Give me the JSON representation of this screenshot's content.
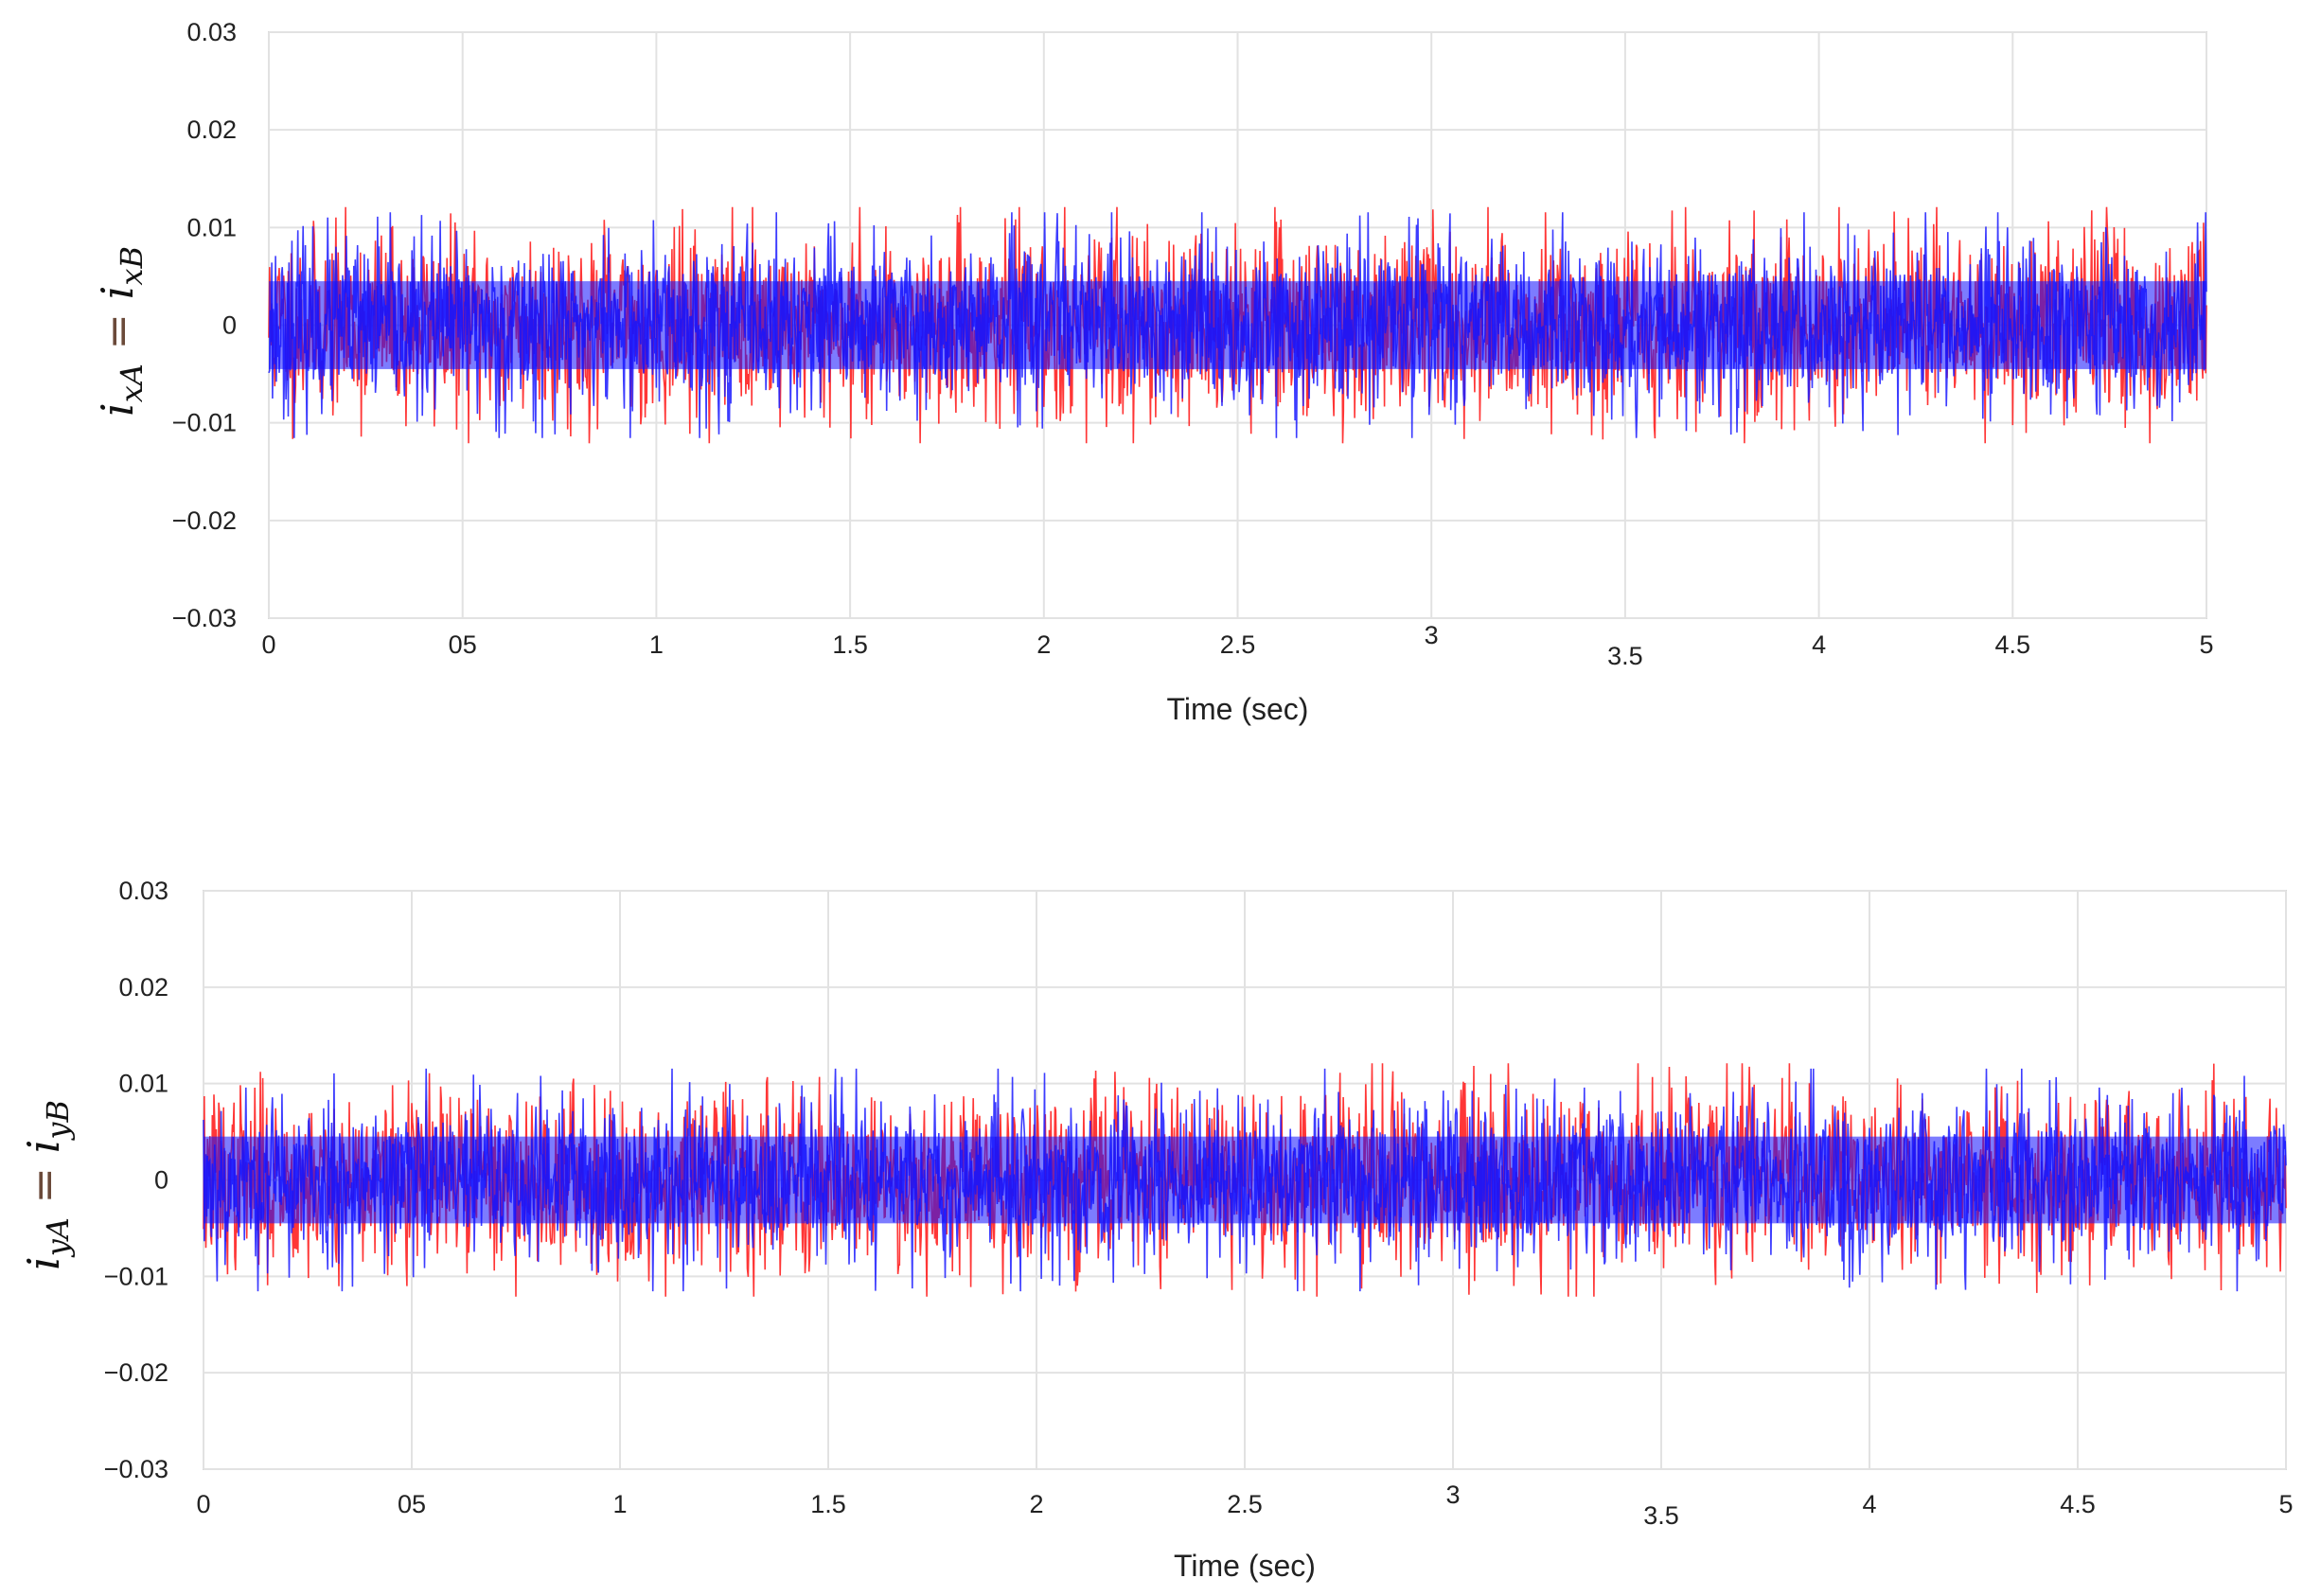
{
  "chart_data": [
    {
      "type": "line",
      "ylabel": "i_xA = i_xB",
      "ylabel_parts": {
        "a": "i",
        "a_sub": "xA",
        "eq": "=",
        "b": "i",
        "b_sub": "xB"
      },
      "xlabel": "Time (sec)",
      "xlim": [
        0,
        5
      ],
      "ylim": [
        -0.03,
        0.03
      ],
      "grid": true,
      "yticks": [
        {
          "v": 0.03,
          "label": "0.03"
        },
        {
          "v": 0.02,
          "label": "0.02"
        },
        {
          "v": 0.01,
          "label": "0.01"
        },
        {
          "v": 0,
          "label": "0"
        },
        {
          "v": -0.01,
          "label": "−0.01"
        },
        {
          "v": -0.02,
          "label": "−0.02"
        },
        {
          "v": -0.03,
          "label": "−0.03"
        }
      ],
      "xticks": [
        {
          "v": 0,
          "label": "0"
        },
        {
          "v": 0.5,
          "label": "05"
        },
        {
          "v": 1,
          "label": "1"
        },
        {
          "v": 1.5,
          "label": "1.5"
        },
        {
          "v": 2,
          "label": "2"
        },
        {
          "v": 2.5,
          "label": "2.5"
        },
        {
          "v": 3,
          "label": "3"
        },
        {
          "v": 3.5,
          "label": "3.5"
        },
        {
          "v": 4,
          "label": "4"
        },
        {
          "v": 4.5,
          "label": "4.5"
        },
        {
          "v": 5,
          "label": "5"
        }
      ],
      "series": [
        {
          "name": "red",
          "color": "#ff2020",
          "mean": 0,
          "amplitude": 0.011,
          "seed": 11
        },
        {
          "name": "blue",
          "color": "#1a1aff",
          "mean": 0,
          "amplitude": 0.0105,
          "seed": 23
        }
      ]
    },
    {
      "type": "line",
      "ylabel": "i_yA = i_yB",
      "ylabel_parts": {
        "a": "i",
        "a_sub": "yA",
        "eq": "=",
        "b": "i",
        "b_sub": "yB"
      },
      "xlabel": "Time (sec)",
      "xlim": [
        0,
        5
      ],
      "ylim": [
        -0.03,
        0.03
      ],
      "grid": true,
      "yticks": [
        {
          "v": 0.03,
          "label": "0.03"
        },
        {
          "v": 0.02,
          "label": "0.02"
        },
        {
          "v": 0.01,
          "label": "0.01"
        },
        {
          "v": 0,
          "label": "0"
        },
        {
          "v": -0.01,
          "label": "−0.01"
        },
        {
          "v": -0.02,
          "label": "−0.02"
        },
        {
          "v": -0.03,
          "label": "−0.03"
        }
      ],
      "xticks": [
        {
          "v": 0,
          "label": "0"
        },
        {
          "v": 0.5,
          "label": "05"
        },
        {
          "v": 1,
          "label": "1"
        },
        {
          "v": 1.5,
          "label": "1.5"
        },
        {
          "v": 2,
          "label": "2"
        },
        {
          "v": 2.5,
          "label": "2.5"
        },
        {
          "v": 3,
          "label": "3"
        },
        {
          "v": 3.5,
          "label": "3.5"
        },
        {
          "v": 4,
          "label": "4"
        },
        {
          "v": 4.5,
          "label": "4.5"
        },
        {
          "v": 5,
          "label": "5"
        }
      ],
      "series": [
        {
          "name": "red",
          "color": "#ff2020",
          "mean": 0,
          "amplitude": 0.011,
          "seed": 37
        },
        {
          "name": "blue",
          "color": "#1a1aff",
          "mean": 0,
          "amplitude": 0.0105,
          "seed": 53
        }
      ]
    }
  ]
}
